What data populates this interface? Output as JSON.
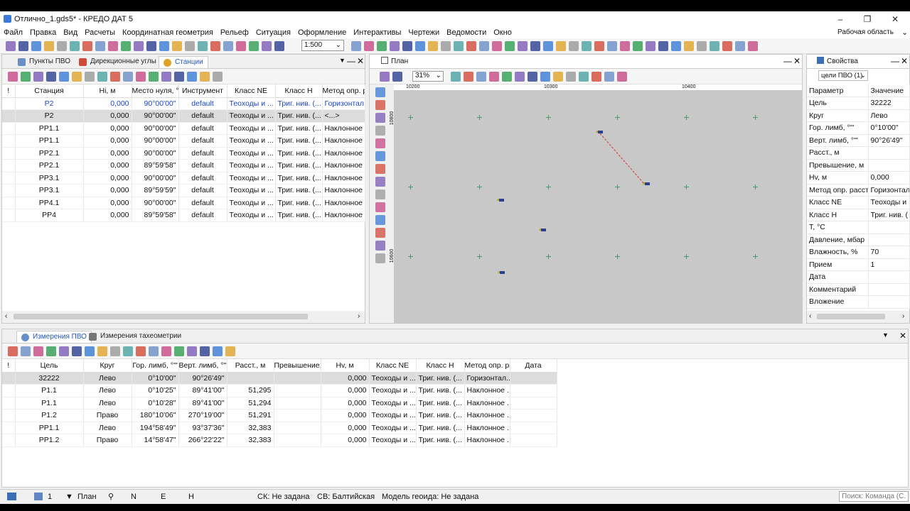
{
  "window": {
    "title": "Отлично_1.gds5* - КРЕДО ДАТ 5",
    "minimize": "–",
    "maximize": "❐",
    "close": "✕"
  },
  "menu": [
    "Файл",
    "Правка",
    "Вид",
    "Расчеты",
    "Координатная геометрия",
    "Рельеф",
    "Ситуация",
    "Оформление",
    "Интерактивы",
    "Чертежи",
    "Ведомости",
    "Окно"
  ],
  "workspace": "Рабочая область",
  "toolbar": {
    "scale": "1:500"
  },
  "top_tabs": [
    {
      "label": "Пункты ПВО"
    },
    {
      "label": "Дирекционные углы"
    },
    {
      "label": "Станции"
    }
  ],
  "stations": {
    "columns": [
      "!",
      "Станция",
      "Hi, м",
      "Место нуля, °'\"",
      "Инструмент",
      "Класс NE",
      "Класс H",
      "Метод опр. расст."
    ],
    "rows": [
      [
        "",
        "Р2",
        "0,000",
        "90°00'00\"",
        "default",
        "Теоходы и ...",
        "Триг. нив. (...",
        "Горизонтал..."
      ],
      [
        "",
        "Р2",
        "0,000",
        "90°00'00\"",
        "default",
        "Теоходы и ...",
        "Триг. нив. (...",
        "<...>"
      ],
      [
        "",
        "РР1.1",
        "0,000",
        "90°00'00\"",
        "default",
        "Теоходы и ...",
        "Триг. нив. (...",
        "Наклонное ..."
      ],
      [
        "",
        "РР1.1",
        "0,000",
        "90°00'00\"",
        "default",
        "Теоходы и ...",
        "Триг. нив. (...",
        "Наклонное ..."
      ],
      [
        "",
        "РР2.1",
        "0,000",
        "90°00'00\"",
        "default",
        "Теоходы и ...",
        "Триг. нив. (...",
        "Наклонное ..."
      ],
      [
        "",
        "РР2.1",
        "0,000",
        "89°59'58\"",
        "default",
        "Теоходы и ...",
        "Триг. нив. (...",
        "Наклонное ..."
      ],
      [
        "",
        "РР3.1",
        "0,000",
        "90°00'00\"",
        "default",
        "Теоходы и ...",
        "Триг. нив. (...",
        "Наклонное ..."
      ],
      [
        "",
        "РР3.1",
        "0,000",
        "89°59'59\"",
        "default",
        "Теоходы и ...",
        "Триг. нив. (...",
        "Наклонное ..."
      ],
      [
        "",
        "РР4.1",
        "0,000",
        "90°00'00\"",
        "default",
        "Теоходы и ...",
        "Триг. нив. (...",
        "Наклонное ..."
      ],
      [
        "",
        "РР4",
        "0,000",
        "89°59'58\"",
        "default",
        "Теоходы и ...",
        "Триг. нив. (...",
        "Наклонное ..."
      ]
    ]
  },
  "plan": {
    "title": "План",
    "zoom": "31%",
    "x_ticks": [
      "10200",
      "10300",
      "10400"
    ],
    "y_ticks": [
      "10800",
      "10600"
    ]
  },
  "properties": {
    "title": "Свойства",
    "selector": "цели ПВО (1)",
    "col_param": "Параметр",
    "col_value": "Значение",
    "rows": [
      [
        "Цель",
        "32222"
      ],
      [
        "Круг",
        "Лево"
      ],
      [
        "Гор. лимб, °'\"",
        "0°10'00\""
      ],
      [
        "Верт. лимб, °'\"",
        "90°26'49\""
      ],
      [
        "Расст., м",
        ""
      ],
      [
        "Превышение, м",
        ""
      ],
      [
        "Hv, м",
        "0,000"
      ],
      [
        "Метод опр. расст.",
        "Горизонтал"
      ],
      [
        "Класс NE",
        "Теоходы и"
      ],
      [
        "Класс H",
        "Триг. нив. ("
      ],
      [
        "T, °C",
        ""
      ],
      [
        "Давление, мбар",
        ""
      ],
      [
        "Влажность, %",
        "70"
      ],
      [
        "Прием",
        "1"
      ],
      [
        "Дата",
        ""
      ],
      [
        "Комментарий",
        ""
      ],
      [
        "Вложение",
        ""
      ]
    ]
  },
  "bottom_tabs": [
    {
      "label": "Измерения ПВО"
    },
    {
      "label": "Измерения тахеометрии"
    }
  ],
  "measurements": {
    "columns": [
      "!",
      "Цель",
      "Круг",
      "Гор. лимб, °'\"",
      "Верт. лимб, °'\"",
      "Расст., м",
      "Превышение, м",
      "Hv, м",
      "Класс NE",
      "Класс H",
      "Метод опр. расст.",
      "Дата"
    ],
    "rows": [
      [
        "",
        "32222",
        "Лево",
        "0°10'00\"",
        "90°26'49\"",
        "",
        "",
        "0,000",
        "Теоходы и ...",
        "Триг. нив. (...",
        "Горизонтал...",
        ""
      ],
      [
        "",
        "Р1.1",
        "Лево",
        "0°10'25\"",
        "89°41'00\"",
        "51,295",
        "",
        "0,000",
        "Теоходы и ...",
        "Триг. нив. (...",
        "Наклонное ...",
        ""
      ],
      [
        "",
        "Р1.1",
        "Лево",
        "0°10'28\"",
        "89°41'00\"",
        "51,294",
        "",
        "0,000",
        "Теоходы и ...",
        "Триг. нив. (...",
        "Наклонное ...",
        ""
      ],
      [
        "",
        "Р1.2",
        "Право",
        "180°10'06\"",
        "270°19'00\"",
        "51,291",
        "",
        "0,000",
        "Теоходы и ...",
        "Триг. нив. (...",
        "Наклонное ...",
        ""
      ],
      [
        "",
        "РР1.1",
        "Лево",
        "194°58'49\"",
        "93°37'36\"",
        "32,383",
        "",
        "0,000",
        "Теоходы и ...",
        "Триг. нив. (...",
        "Наклонное ...",
        ""
      ],
      [
        "",
        "РР1.2",
        "Право",
        "14°58'47\"",
        "266°22'22\"",
        "32,383",
        "",
        "0,000",
        "Теоходы и ...",
        "Триг. нив. (...",
        "Наклонное ...",
        ""
      ]
    ]
  },
  "status": {
    "count": "1",
    "plan": "План",
    "n": "N",
    "e": "E",
    "h": "H",
    "sk": "СК: Не задана",
    "sv": "СВ: Балтийская",
    "geoid": "Модель геоида: Не задана",
    "search_placeholder": "Поиск: Команда (C..."
  },
  "colors": {
    "accent": "#2356c5",
    "station_box": "#2b3f8f",
    "grid_cross": "#4c9a6c",
    "link_line": "#e03030"
  }
}
